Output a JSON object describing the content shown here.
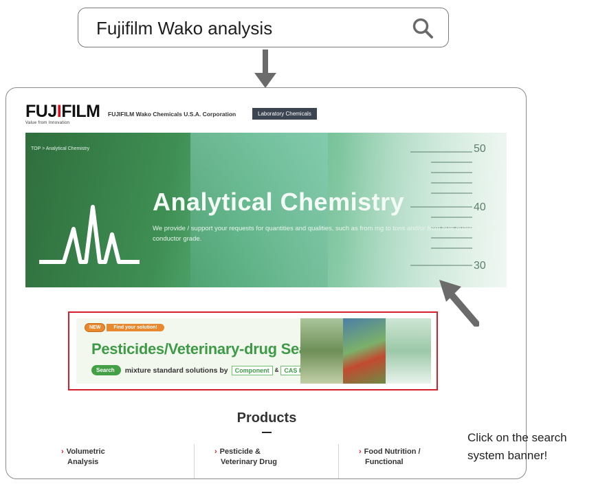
{
  "search": {
    "query": "Fujifilm Wako analysis",
    "icon": "search-icon"
  },
  "site": {
    "logo_text": "FUJIFILM",
    "logo_tagline": "Value from Innovation",
    "corp_name": "FUJIFILM Wako Chemicals U.S.A. Corporation",
    "corp_badge": "Laboratory Chemicals"
  },
  "hero": {
    "breadcrumb": "TOP > Analytical Chemistry",
    "title": "Analytical Chemistry",
    "description": "We provide / support your requests for quantities and qualities, such as from mg to tons and/or from bulk quality to semi-conductor grade."
  },
  "promo": {
    "badge_new": "NEW",
    "badge_find": "Find your solution!",
    "headline": "Pesticides/Veterinary-drug Search",
    "search_pill": "Search",
    "sub_text": "mixture standard solutions by",
    "option1": "Component",
    "amp": "&",
    "option2": "CAS RN®"
  },
  "products": {
    "title": "Products",
    "items": [
      {
        "line1": "Volumetric",
        "line2": "Analysis"
      },
      {
        "line1": "Pesticide &",
        "line2": "Veterinary Drug"
      },
      {
        "line1": "Food Nutrition /",
        "line2": "Functional"
      }
    ]
  },
  "callout": {
    "line1": "Click on the search",
    "line2": "system banner!"
  },
  "colors": {
    "accent_red": "#d21f2a",
    "green": "#3f9a47",
    "orange": "#e8892f"
  }
}
